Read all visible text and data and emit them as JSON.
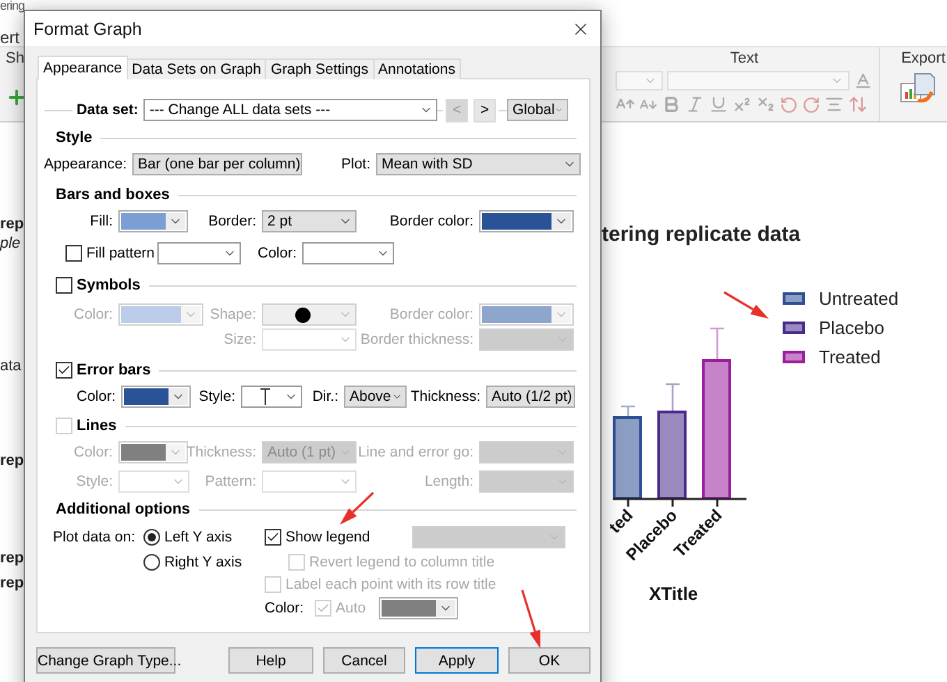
{
  "app": {
    "title": "ering",
    "menu_fragment": "ert",
    "tab_fragment": "Sh",
    "side_items": [
      {
        "text": "rep",
        "kind": "bold"
      },
      {
        "text": "ple",
        "kind": "italic"
      },
      {
        "text": "ata",
        "kind": "plain"
      },
      {
        "text": "rep",
        "kind": "bold"
      },
      {
        "text": "rep",
        "kind": "bold"
      },
      {
        "text": "rep",
        "kind": "bold"
      }
    ]
  },
  "ribbon": {
    "text_group": "Text",
    "export_group": "Export"
  },
  "graph": {
    "title": "tering replicate data",
    "categories": [
      "ted",
      "Placebo",
      "Treated"
    ],
    "x_title": "XTitle",
    "legend": [
      {
        "label": "Untreated",
        "color": "#2d4f93"
      },
      {
        "label": "Placebo",
        "color": "#4a2a8a"
      },
      {
        "label": "Treated",
        "color": "#9a1e9e"
      }
    ]
  },
  "dialog": {
    "title": "Format Graph",
    "tabs": [
      {
        "label": "Appearance",
        "selected": true
      },
      {
        "label": "Data Sets on Graph",
        "selected": false
      },
      {
        "label": "Graph Settings",
        "selected": false
      },
      {
        "label": "Annotations",
        "selected": false
      }
    ],
    "data_set": {
      "label": "Data set:",
      "value": "--- Change ALL data sets ---",
      "prev": {
        "label": "<",
        "disabled": true
      },
      "next": {
        "label": ">",
        "disabled": false
      },
      "scope": "Global"
    },
    "style": {
      "heading": "Style",
      "appearance": {
        "label": "Appearance:",
        "kind": "list",
        "value": "Bar (one bar per column)"
      },
      "plot": {
        "label": "Plot:",
        "kind": "list",
        "value": "Mean with SD"
      }
    },
    "bars": {
      "heading": "Bars and boxes",
      "fill": {
        "label": "Fill:",
        "kind": "color",
        "color": "#7b9fd4"
      },
      "border": {
        "label": "Border:",
        "kind": "list",
        "value": "2 pt"
      },
      "border_color": {
        "label": "Border color:",
        "kind": "color",
        "color": "#2a5297"
      },
      "fill_pattern": {
        "label": "Fill pattern",
        "checked": false
      },
      "pattern": {
        "kind": "edit"
      },
      "pattern_color": {
        "label": "Color:",
        "kind": "edit"
      }
    },
    "symbols": {
      "heading": "Symbols",
      "checked": false,
      "color": {
        "label": "Color:",
        "kind": "color",
        "color": "#bccde9"
      },
      "shape": {
        "label": "Shape:",
        "kind": "shape"
      },
      "border_color": {
        "label": "Border color:",
        "kind": "color",
        "color": "#8fa6cc"
      },
      "size": {
        "label": "Size:",
        "kind": "edit"
      },
      "border_thickness": {
        "label": "Border thickness:",
        "kind": "list"
      }
    },
    "error_bars": {
      "heading": "Error bars",
      "checked": true,
      "color": {
        "label": "Color:",
        "kind": "color",
        "color": "#2a5297"
      },
      "style": {
        "label": "Style:",
        "kind": "cap"
      },
      "direction": {
        "label": "Dir.:",
        "kind": "list",
        "value": "Above"
      },
      "thickness": {
        "label": "Thickness:",
        "kind": "list",
        "value": "Auto (1/2 pt)"
      }
    },
    "lines": {
      "heading": "Lines",
      "checked": false,
      "disabled": true,
      "color": {
        "label": "Color:",
        "kind": "color",
        "color": "#808080"
      },
      "thickness": {
        "label": "Thickness:",
        "kind": "list",
        "value": "Auto (1 pt)"
      },
      "line_and_error": {
        "label": "Line and error go:",
        "kind": "list"
      },
      "style": {
        "label": "Style:",
        "kind": "edit"
      },
      "pattern": {
        "label": "Pattern:",
        "kind": "edit"
      },
      "length": {
        "label": "Length:",
        "kind": "list"
      }
    },
    "additional": {
      "heading": "Additional options",
      "plot_on_label": "Plot data on:",
      "axes": [
        {
          "label": "Left Y axis",
          "selected": true
        },
        {
          "label": "Right  Y axis",
          "selected": false
        }
      ],
      "show_legend": {
        "label": "Show legend",
        "checked": true,
        "disabled": false
      },
      "legend_combo": {
        "kind": "list",
        "disabled": true
      },
      "revert": {
        "label": "Revert legend to column title",
        "checked": false,
        "disabled": true
      },
      "label_points": {
        "label": "Label each point with its row title",
        "checked": false,
        "disabled": true
      },
      "color_label": "Color:",
      "auto": {
        "label": "Auto",
        "checked": true,
        "disabled": true
      },
      "swatch": {
        "kind": "color",
        "color": "#808080"
      }
    },
    "buttons": [
      {
        "label": "Change Graph Type...",
        "focused": false
      },
      {
        "label": "Help",
        "focused": false
      },
      {
        "label": "Cancel",
        "focused": false
      },
      {
        "label": "Apply",
        "focused": true
      },
      {
        "label": "OK",
        "focused": false
      }
    ]
  }
}
